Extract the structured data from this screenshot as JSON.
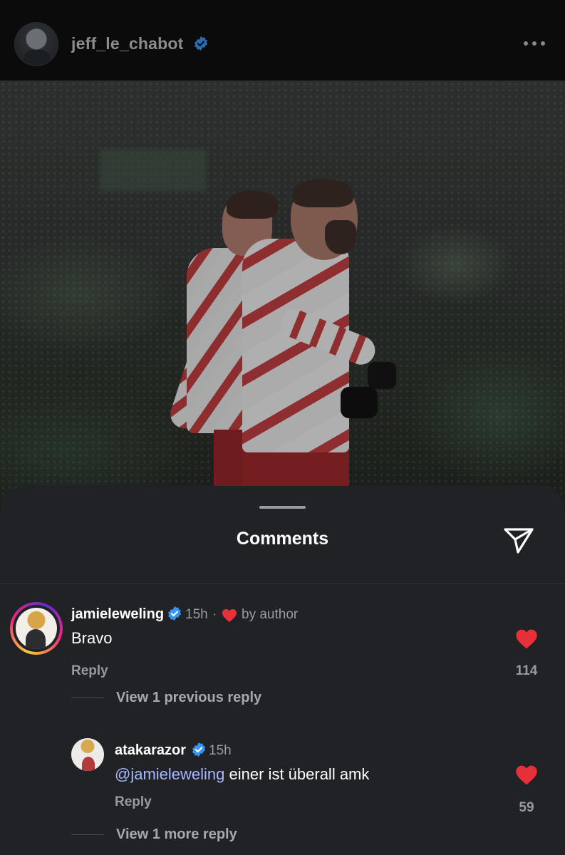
{
  "post": {
    "author": "jeff_le_chabot",
    "author_verified": true
  },
  "sheet": {
    "title": "Comments"
  },
  "comments": [
    {
      "user": "jamieleweling",
      "verified": true,
      "time": "15h",
      "separator": "·",
      "author_like_label": "by author",
      "text": "Bravo",
      "reply_label": "Reply",
      "likes": "114",
      "view_replies": "View 1 previous reply"
    },
    {
      "user": "atakarazor",
      "verified": true,
      "time": "15h",
      "mention": "@jamieleweling",
      "text": " einer ist überall amk",
      "reply_label": "Reply",
      "likes": "59",
      "view_replies": "View 1 more reply"
    }
  ],
  "colors": {
    "heart": "#e8303a",
    "verified": "#3797f0",
    "mention": "#a6b8ff",
    "sheet_bg": "#212226"
  },
  "icons": [
    "verified-badge-icon",
    "more-options-icon",
    "share-send-icon",
    "heart-icon"
  ]
}
